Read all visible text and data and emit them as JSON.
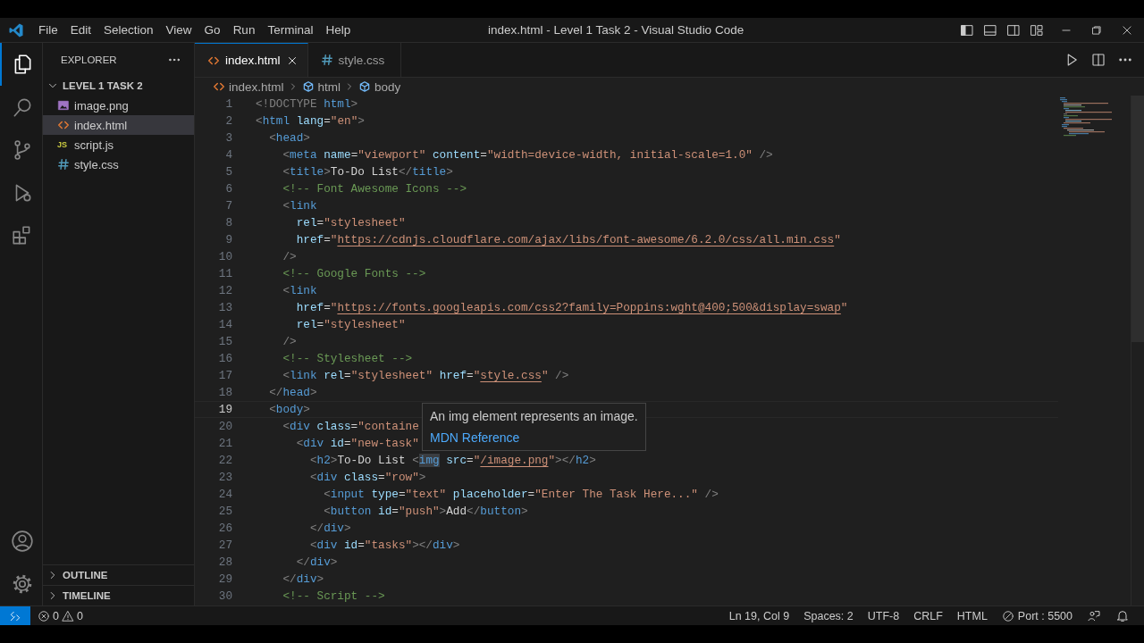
{
  "title_bar": {
    "menus": [
      "File",
      "Edit",
      "Selection",
      "View",
      "Go",
      "Run",
      "Terminal",
      "Help"
    ],
    "title": "index.html - Level 1 Task 2 - Visual Studio Code"
  },
  "activity_bar": {
    "items": [
      {
        "kind": "files",
        "selected": true
      },
      {
        "kind": "search",
        "selected": false
      },
      {
        "kind": "source-control",
        "selected": false
      },
      {
        "kind": "run",
        "selected": false
      },
      {
        "kind": "extensions",
        "selected": false
      }
    ],
    "bottom": [
      {
        "kind": "account"
      },
      {
        "kind": "settings"
      }
    ]
  },
  "sidebar": {
    "title": "EXPLORER",
    "folder": {
      "name": "LEVEL 1 TASK 2",
      "expanded": true,
      "children": [
        {
          "name": "image.png",
          "kind": "image",
          "selected": false
        },
        {
          "name": "index.html",
          "kind": "html",
          "selected": true
        },
        {
          "name": "script.js",
          "kind": "js",
          "badge": "JS",
          "selected": false
        },
        {
          "name": "style.css",
          "kind": "css",
          "selected": false
        }
      ]
    },
    "sections": [
      {
        "name": "OUTLINE",
        "expanded": false
      },
      {
        "name": "TIMELINE",
        "expanded": false
      }
    ]
  },
  "tabs": [
    {
      "label": "index.html",
      "kind": "html",
      "selected": true
    },
    {
      "label": "style.css",
      "kind": "css",
      "selected": false
    }
  ],
  "breadcrumb": [
    {
      "label": "index.html",
      "kind": "html"
    },
    {
      "label": "html",
      "kind": "element"
    },
    {
      "label": "body",
      "kind": "element"
    }
  ],
  "editor": {
    "lines": [
      {
        "number": "1",
        "current": false,
        "tokens": [
          {
            "kind": "punct",
            "text": "<!DOCTYPE "
          },
          {
            "kind": "tag",
            "text": "html"
          },
          {
            "kind": "punct",
            "text": ">"
          }
        ]
      },
      {
        "number": "2",
        "current": false,
        "tokens": [
          {
            "kind": "punct",
            "text": "<"
          },
          {
            "kind": "tag",
            "text": "html"
          },
          {
            "kind": "attr",
            "text": " lang"
          },
          {
            "kind": "text",
            "text": "="
          },
          {
            "kind": "string",
            "text": "\"en\""
          },
          {
            "kind": "punct",
            "text": ">"
          }
        ]
      },
      {
        "number": "3",
        "current": false,
        "tokens": [
          {
            "kind": "punct",
            "text": "  <"
          },
          {
            "kind": "tag",
            "text": "head"
          },
          {
            "kind": "punct",
            "text": ">"
          }
        ]
      },
      {
        "number": "4",
        "current": false,
        "tokens": [
          {
            "kind": "punct",
            "text": "    <"
          },
          {
            "kind": "tag",
            "text": "meta"
          },
          {
            "kind": "attr",
            "text": " name"
          },
          {
            "kind": "text",
            "text": "="
          },
          {
            "kind": "string",
            "text": "\"viewport\""
          },
          {
            "kind": "attr",
            "text": " content"
          },
          {
            "kind": "text",
            "text": "="
          },
          {
            "kind": "string",
            "text": "\"width=device-width, initial-scale=1.0\""
          },
          {
            "kind": "punct",
            "text": " />"
          }
        ]
      },
      {
        "number": "5",
        "current": false,
        "tokens": [
          {
            "kind": "punct",
            "text": "    <"
          },
          {
            "kind": "tag",
            "text": "title"
          },
          {
            "kind": "punct",
            "text": ">"
          },
          {
            "kind": "text",
            "text": "To-Do List"
          },
          {
            "kind": "punct",
            "text": "</"
          },
          {
            "kind": "tag",
            "text": "title"
          },
          {
            "kind": "punct",
            "text": ">"
          }
        ]
      },
      {
        "number": "6",
        "current": false,
        "tokens": [
          {
            "kind": "comment",
            "text": "    <!-- Font Awesome Icons -->"
          }
        ]
      },
      {
        "number": "7",
        "current": false,
        "tokens": [
          {
            "kind": "punct",
            "text": "    <"
          },
          {
            "kind": "tag",
            "text": "link"
          }
        ]
      },
      {
        "number": "8",
        "current": false,
        "tokens": [
          {
            "kind": "attr",
            "text": "      rel"
          },
          {
            "kind": "text",
            "text": "="
          },
          {
            "kind": "string",
            "text": "\"stylesheet\""
          }
        ]
      },
      {
        "number": "9",
        "current": false,
        "tokens": [
          {
            "kind": "attr",
            "text": "      href"
          },
          {
            "kind": "text",
            "text": "="
          },
          {
            "kind": "string",
            "text": "\""
          },
          {
            "kind": "link",
            "text": "https://cdnjs.cloudflare.com/ajax/libs/font-awesome/6.2.0/css/all.min.css"
          },
          {
            "kind": "string",
            "text": "\""
          }
        ]
      },
      {
        "number": "10",
        "current": false,
        "tokens": [
          {
            "kind": "punct",
            "text": "    />"
          }
        ]
      },
      {
        "number": "11",
        "current": false,
        "tokens": [
          {
            "kind": "comment",
            "text": "    <!-- Google Fonts -->"
          }
        ]
      },
      {
        "number": "12",
        "current": false,
        "tokens": [
          {
            "kind": "punct",
            "text": "    <"
          },
          {
            "kind": "tag",
            "text": "link"
          }
        ]
      },
      {
        "number": "13",
        "current": false,
        "tokens": [
          {
            "kind": "attr",
            "text": "      href"
          },
          {
            "kind": "text",
            "text": "="
          },
          {
            "kind": "string",
            "text": "\""
          },
          {
            "kind": "link",
            "text": "https://fonts.googleapis.com/css2?family=Poppins:wght@400;500&display=swap"
          },
          {
            "kind": "string",
            "text": "\""
          }
        ]
      },
      {
        "number": "14",
        "current": false,
        "tokens": [
          {
            "kind": "attr",
            "text": "      rel"
          },
          {
            "kind": "text",
            "text": "="
          },
          {
            "kind": "string",
            "text": "\"stylesheet\""
          }
        ]
      },
      {
        "number": "15",
        "current": false,
        "tokens": [
          {
            "kind": "punct",
            "text": "    />"
          }
        ]
      },
      {
        "number": "16",
        "current": false,
        "tokens": [
          {
            "kind": "comment",
            "text": "    <!-- Stylesheet -->"
          }
        ]
      },
      {
        "number": "17",
        "current": false,
        "tokens": [
          {
            "kind": "punct",
            "text": "    <"
          },
          {
            "kind": "tag",
            "text": "link"
          },
          {
            "kind": "attr",
            "text": " rel"
          },
          {
            "kind": "text",
            "text": "="
          },
          {
            "kind": "string",
            "text": "\"stylesheet\""
          },
          {
            "kind": "attr",
            "text": " href"
          },
          {
            "kind": "text",
            "text": "="
          },
          {
            "kind": "string",
            "text": "\""
          },
          {
            "kind": "link",
            "text": "style.css"
          },
          {
            "kind": "string",
            "text": "\""
          },
          {
            "kind": "punct",
            "text": " />"
          }
        ]
      },
      {
        "number": "18",
        "current": false,
        "tokens": [
          {
            "kind": "punct",
            "text": "  </"
          },
          {
            "kind": "tag",
            "text": "head"
          },
          {
            "kind": "punct",
            "text": ">"
          }
        ]
      },
      {
        "number": "19",
        "current": true,
        "tokens": [
          {
            "kind": "punct",
            "text": "  <"
          },
          {
            "kind": "tag",
            "text": "body"
          },
          {
            "kind": "punct",
            "text": ">"
          }
        ]
      },
      {
        "number": "20",
        "current": false,
        "tokens": [
          {
            "kind": "punct",
            "text": "    <"
          },
          {
            "kind": "tag",
            "text": "div"
          },
          {
            "kind": "attr",
            "text": " class"
          },
          {
            "kind": "text",
            "text": "="
          },
          {
            "kind": "string",
            "text": "\"containe"
          }
        ]
      },
      {
        "number": "21",
        "current": false,
        "tokens": [
          {
            "kind": "punct",
            "text": "      <"
          },
          {
            "kind": "tag",
            "text": "div"
          },
          {
            "kind": "attr",
            "text": " id"
          },
          {
            "kind": "text",
            "text": "="
          },
          {
            "kind": "string",
            "text": "\"new-task\""
          }
        ]
      },
      {
        "number": "22",
        "current": false,
        "tokens": [
          {
            "kind": "punct",
            "text": "        <"
          },
          {
            "kind": "tag",
            "text": "h2"
          },
          {
            "kind": "punct",
            "text": ">"
          },
          {
            "kind": "text",
            "text": "To-Do List "
          },
          {
            "kind": "punct",
            "text": "<"
          },
          {
            "kind": "hovered-tag",
            "text": "img"
          },
          {
            "kind": "attr",
            "text": " src"
          },
          {
            "kind": "text",
            "text": "="
          },
          {
            "kind": "string",
            "text": "\""
          },
          {
            "kind": "link",
            "text": "/image.png"
          },
          {
            "kind": "string",
            "text": "\""
          },
          {
            "kind": "punct",
            "text": "></"
          },
          {
            "kind": "tag",
            "text": "h2"
          },
          {
            "kind": "punct",
            "text": ">"
          }
        ]
      },
      {
        "number": "23",
        "current": false,
        "tokens": [
          {
            "kind": "punct",
            "text": "        <"
          },
          {
            "kind": "tag",
            "text": "div"
          },
          {
            "kind": "attr",
            "text": " class"
          },
          {
            "kind": "text",
            "text": "="
          },
          {
            "kind": "string",
            "text": "\"row\""
          },
          {
            "kind": "punct",
            "text": ">"
          }
        ]
      },
      {
        "number": "24",
        "current": false,
        "tokens": [
          {
            "kind": "punct",
            "text": "          <"
          },
          {
            "kind": "tag",
            "text": "input"
          },
          {
            "kind": "attr",
            "text": " type"
          },
          {
            "kind": "text",
            "text": "="
          },
          {
            "kind": "string",
            "text": "\"text\""
          },
          {
            "kind": "attr",
            "text": " placeholder"
          },
          {
            "kind": "text",
            "text": "="
          },
          {
            "kind": "string",
            "text": "\"Enter The Task Here...\""
          },
          {
            "kind": "punct",
            "text": " />"
          }
        ]
      },
      {
        "number": "25",
        "current": false,
        "tokens": [
          {
            "kind": "punct",
            "text": "          <"
          },
          {
            "kind": "tag",
            "text": "button"
          },
          {
            "kind": "attr",
            "text": " id"
          },
          {
            "kind": "text",
            "text": "="
          },
          {
            "kind": "string",
            "text": "\"push\""
          },
          {
            "kind": "punct",
            "text": ">"
          },
          {
            "kind": "text",
            "text": "Add"
          },
          {
            "kind": "punct",
            "text": "</"
          },
          {
            "kind": "tag",
            "text": "button"
          },
          {
            "kind": "punct",
            "text": ">"
          }
        ]
      },
      {
        "number": "26",
        "current": false,
        "tokens": [
          {
            "kind": "punct",
            "text": "        </"
          },
          {
            "kind": "tag",
            "text": "div"
          },
          {
            "kind": "punct",
            "text": ">"
          }
        ]
      },
      {
        "number": "27",
        "current": false,
        "tokens": [
          {
            "kind": "punct",
            "text": "        <"
          },
          {
            "kind": "tag",
            "text": "div"
          },
          {
            "kind": "attr",
            "text": " id"
          },
          {
            "kind": "text",
            "text": "="
          },
          {
            "kind": "string",
            "text": "\"tasks\""
          },
          {
            "kind": "punct",
            "text": "></"
          },
          {
            "kind": "tag",
            "text": "div"
          },
          {
            "kind": "punct",
            "text": ">"
          }
        ]
      },
      {
        "number": "28",
        "current": false,
        "tokens": [
          {
            "kind": "punct",
            "text": "      </"
          },
          {
            "kind": "tag",
            "text": "div"
          },
          {
            "kind": "punct",
            "text": ">"
          }
        ]
      },
      {
        "number": "29",
        "current": false,
        "tokens": [
          {
            "kind": "punct",
            "text": "    </"
          },
          {
            "kind": "tag",
            "text": "div"
          },
          {
            "kind": "punct",
            "text": ">"
          }
        ]
      },
      {
        "number": "30",
        "current": false,
        "tokens": [
          {
            "kind": "comment",
            "text": "    <!-- Script -->"
          }
        ]
      }
    ],
    "hover": {
      "text": "An img element represents an image.",
      "link": "MDN Reference"
    }
  },
  "status_bar": {
    "errors": "0",
    "warnings": "0",
    "items": [
      {
        "label": "Ln 19, Col 9",
        "kind": "text"
      },
      {
        "label": "Spaces: 2",
        "kind": "text"
      },
      {
        "label": "UTF-8",
        "kind": "text"
      },
      {
        "label": "CRLF",
        "kind": "text"
      },
      {
        "label": "HTML",
        "kind": "text"
      },
      {
        "label": "Port : 5500",
        "kind": "port"
      }
    ]
  }
}
